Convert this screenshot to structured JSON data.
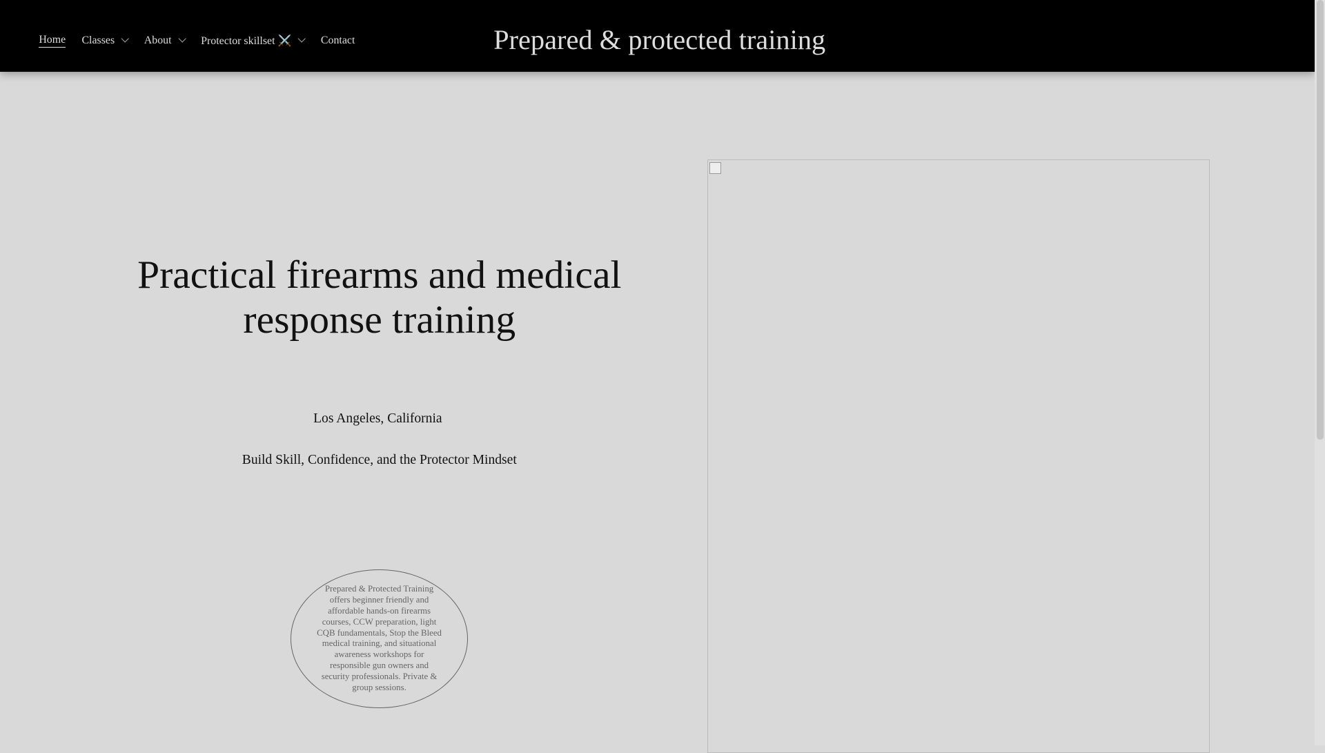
{
  "nav": {
    "items": [
      {
        "label": "Home"
      },
      {
        "label": "Classes"
      },
      {
        "label": "About"
      },
      {
        "label": "Protector skillset ⚔️"
      },
      {
        "label": "Contact"
      }
    ]
  },
  "brand": "Prepared & protected training",
  "hero": {
    "title": "Practical firearms and medical response training",
    "location": "Los Angeles, California",
    "tagline": "Build Skill, Confidence, and the Protector Mindset",
    "description": "Prepared & Protected Training offers beginner friendly and affordable hands-on firearms courses, CCW preparation, light CQB fundamentals, Stop the Bleed medical training, and situational awareness workshops for responsible gun owners and security professionals. Private & group sessions."
  }
}
